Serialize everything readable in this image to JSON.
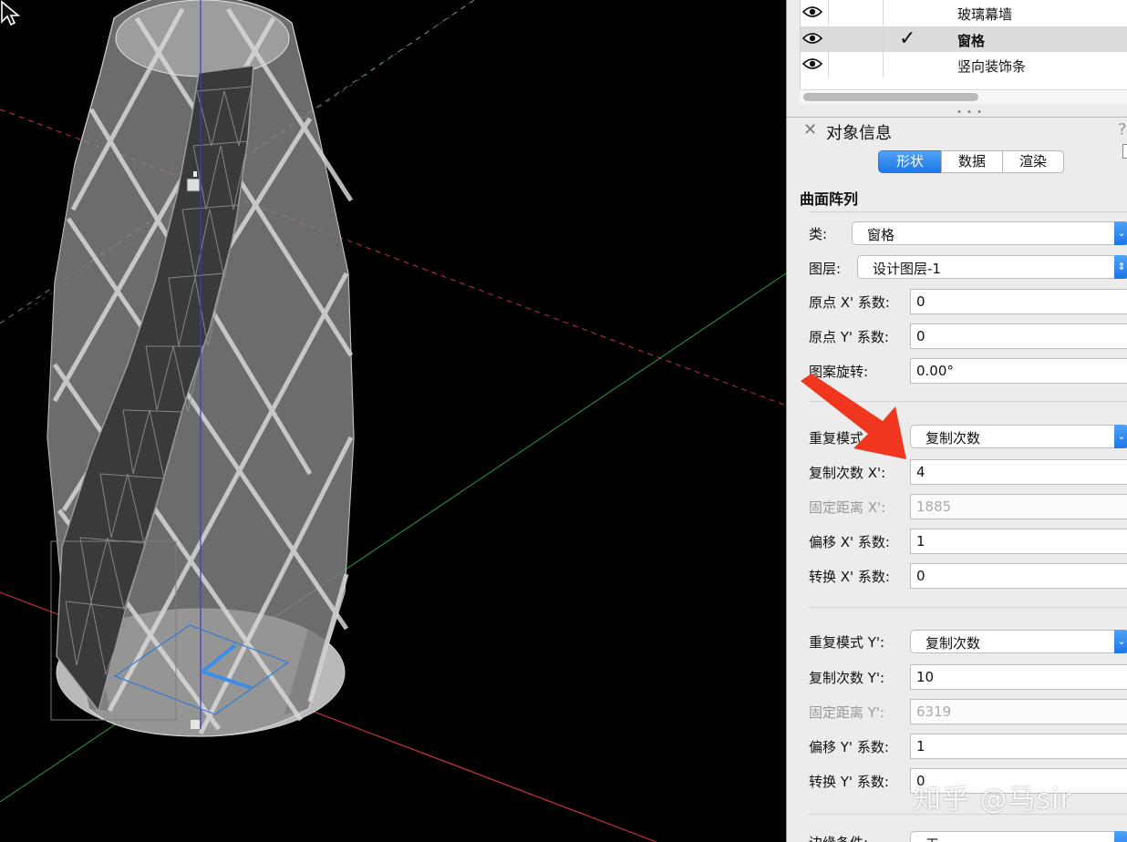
{
  "layers": {
    "rows": [
      {
        "name": "玻璃幕墙",
        "checked": false,
        "selected": false
      },
      {
        "name": "窗格",
        "checked": true,
        "selected": true
      },
      {
        "name": "竖向装饰条",
        "checked": false,
        "selected": false
      }
    ],
    "check_glyph": "✓"
  },
  "object_info": {
    "title": "对象信息",
    "close_glyph": "✕",
    "help_glyph": "?",
    "tabs": [
      "形状",
      "数据",
      "渲染"
    ],
    "active_tab": "形状",
    "object_type": "曲面阵列",
    "fields": {
      "class": {
        "label": "类:",
        "value": "窗格"
      },
      "layer": {
        "label": "图层:",
        "value": "设计图层-1"
      },
      "origin_x": {
        "label": "原点 X' 系数:",
        "value": "0"
      },
      "origin_y": {
        "label": "原点 Y' 系数:",
        "value": "0"
      },
      "pattern_rotation": {
        "label": "图案旋转:",
        "value": "0.00°"
      },
      "repeat_mode_x": {
        "label": "重复模式 X':",
        "value": "复制次数"
      },
      "copies_x": {
        "label": "复制次数 X':",
        "value": "4"
      },
      "fixed_distance_x": {
        "label": "固定距离 X':",
        "value": "1885"
      },
      "offset_x": {
        "label": "偏移 X' 系数:",
        "value": "1"
      },
      "transform_x": {
        "label": "转换 X' 系数:",
        "value": "0"
      },
      "repeat_mode_y": {
        "label": "重复模式 Y':",
        "value": "复制次数"
      },
      "copies_y": {
        "label": "复制次数 Y':",
        "value": "10"
      },
      "fixed_distance_y": {
        "label": "固定距离 Y':",
        "value": "6319"
      },
      "offset_y": {
        "label": "偏移 Y' 系数:",
        "value": "1"
      },
      "transform_y": {
        "label": "转换 Y' 系数:",
        "value": "0"
      },
      "trim_condition": {
        "label": "边缘条件:",
        "value": "无"
      }
    }
  },
  "watermark": "知乎 @马sir",
  "colors": {
    "accent": "#1d76e8",
    "arrow": "#f0361f",
    "axis_x": "#c8323c",
    "axis_y": "#2f9a3a",
    "axis_z": "#3a3acd"
  },
  "icons": {
    "eye": "eye-icon",
    "close": "close-icon",
    "cursor": "mouse-pointer-icon",
    "popup": "chevron-down-icon"
  }
}
